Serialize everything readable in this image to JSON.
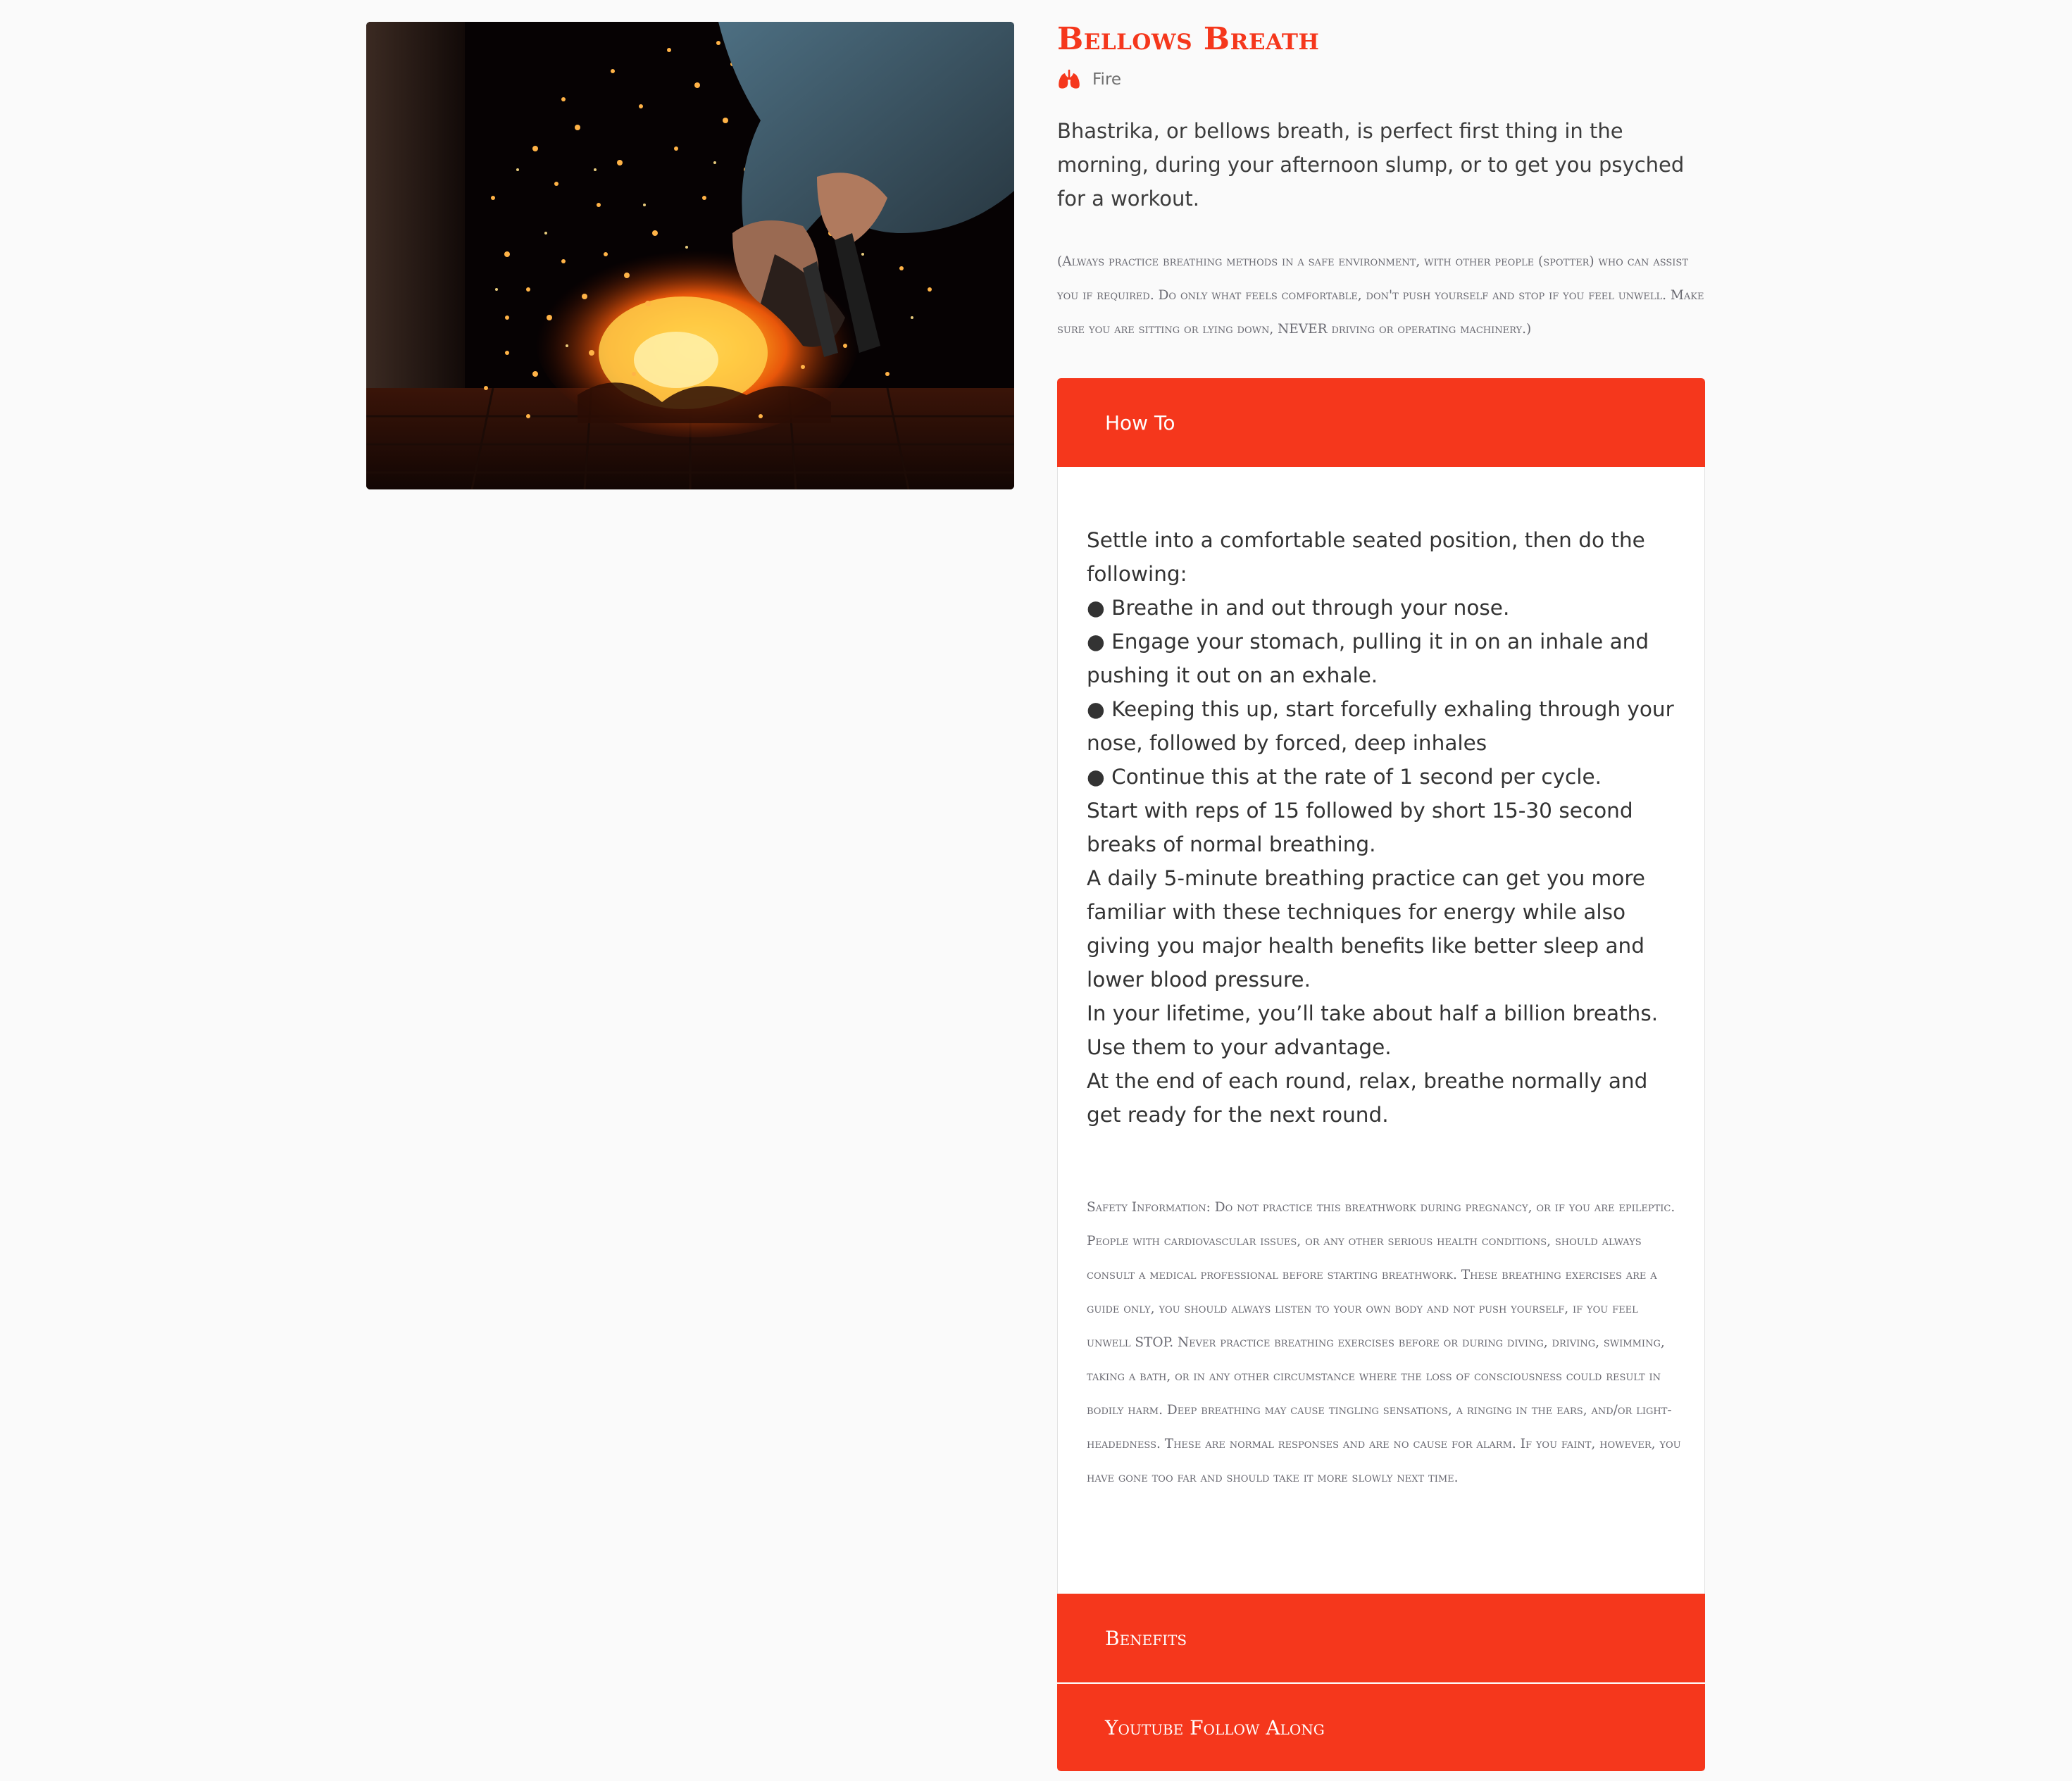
{
  "exercise": {
    "title": "Bellows Breath",
    "element_icon": "lungs-icon",
    "element_label": "Fire",
    "intro": "Bhastrika, or bellows breath, is perfect first thing in the morning, during your afternoon slump, or to get you psyched for a workout.",
    "disclaimer": "(Always practice breathing methods in a safe environment, with other people (spotter) who can assist you if required. Do only what feels comfortable, don't push yourself and stop if you feel unwell. Make sure you are sitting or lying down, NEVER driving or operating machinery.)"
  },
  "accordion": {
    "howto_label": "How To",
    "howto_lines": [
      "Settle into a comfortable seated position, then do the following:",
      "● Breathe in and out through your nose.",
      "● Engage your stomach, pulling it in on an inhale and pushing it out on an exhale.",
      "● Keeping this up, start forcefully exhaling through your nose, followed by forced, deep inhales",
      "● Continue this at the rate of 1 second per cycle.",
      "Start with reps of 15 followed by short 15-30 second breaks of normal breathing.",
      "A daily 5-minute breathing practice can get you more familiar with these techniques for energy while also giving you major health benefits like better sleep and lower blood pressure.",
      "In your lifetime, you’ll take about half a billion breaths. Use them to your advantage.",
      "At the end of each round, relax, breathe normally and get ready for the next round."
    ],
    "safety": "Safety Information: Do not practice this breathwork during pregnancy, or if you are epileptic. People with cardiovascular issues, or any other serious health conditions, should always consult a medical professional before starting breathwork. These breathing exercises are a guide only, you should always listen to your own body and not push yourself, if you feel unwell STOP. Never practice breathing exercises before or during diving, driving, swimming, taking a bath, or in any other circumstance where the loss of consciousness could result in bodily harm. Deep breathing may cause tingling sensations, a ringing in the ears, and/or light-headedness. These are normal responses and are no cause for alarm. If you faint, however, you have gone too far and should take it more slowly next time.",
    "benefits_label": "Benefits",
    "youtube_label": "Youtube Follow Along"
  },
  "colors": {
    "accent": "#f5371c",
    "background": "#fafafa"
  }
}
